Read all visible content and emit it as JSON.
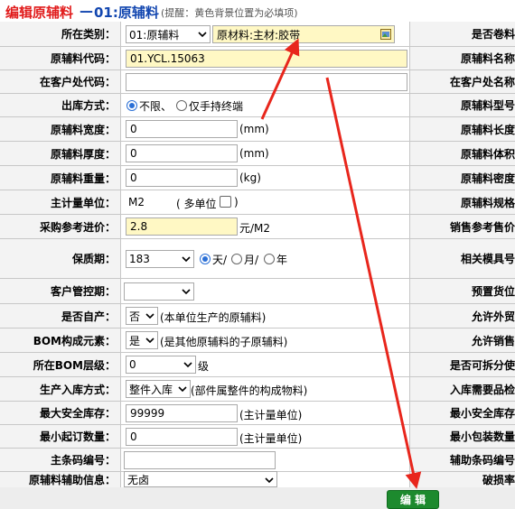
{
  "header": {
    "title_red": "编辑原辅料",
    "separator": "—",
    "title_blue": "01:原辅料",
    "hint": "(提醒：黄色背景位置为必填项)"
  },
  "rows": {
    "category": {
      "label": "所在类别：",
      "select_value": "01:原辅料",
      "path_value": "原材料:主材:胶带",
      "right_label": "是否卷料"
    },
    "code": {
      "label": "原辅料代码：",
      "value": "01.YCL.15063",
      "right_label": "原辅料名称"
    },
    "cust_code": {
      "label": "在客户处代码：",
      "value": "",
      "right_label": "在客户处名称"
    },
    "outbound": {
      "label": "出库方式：",
      "opt1": "不限、",
      "opt2": "仅手持终端",
      "right_label": "原辅料型号"
    },
    "width": {
      "label": "原辅料宽度：",
      "value": "0",
      "unit": "(mm)",
      "right_label": "原辅料长度"
    },
    "thickness": {
      "label": "原辅料厚度：",
      "value": "0",
      "unit": "(mm)",
      "right_label": "原辅料体积"
    },
    "weight": {
      "label": "原辅料重量：",
      "value": "0",
      "unit": "(kg)",
      "right_label": "原辅料密度"
    },
    "main_unit": {
      "label": "主计量单位：",
      "value": "M2",
      "multi": "( 多单位",
      "close": ")",
      "right_label": "原辅料规格"
    },
    "purchase_price": {
      "label": "采购参考进价：",
      "value": "2.8",
      "unit": "元/M2",
      "right_label": "销售参考售价"
    },
    "shelf_life": {
      "label": "保质期：",
      "value": "183",
      "opt_day": "天/",
      "opt_month": "月/",
      "opt_year": "年",
      "right_label": "相关模具号"
    },
    "customer_ctrl": {
      "label": "客户管控期：",
      "value": "",
      "right_label": "预置货位"
    },
    "self_produced": {
      "label": "是否自产：",
      "value": "否",
      "note": "(本单位生产的原辅料)",
      "right_label": "允许外贸"
    },
    "bom_element": {
      "label": "BOM构成元素：",
      "value": "是",
      "note": "(是其他原辅料的子原辅料)",
      "right_label": "允许销售"
    },
    "bom_level": {
      "label": "所在BOM层级：",
      "value": "0",
      "unit": "级",
      "right_label": "是否可拆分使"
    },
    "production_in": {
      "label": "生产入库方式：",
      "value": "整件入库",
      "note": "(部件属整件的构成物料)",
      "right_label": "入库需要品检"
    },
    "max_stock": {
      "label": "最大安全库存：",
      "value": "99999",
      "unit": "(主计量单位)",
      "right_label": "最小安全库存"
    },
    "min_order": {
      "label": "最小起订数量：",
      "value": "0",
      "unit": "(主计量单位)",
      "right_label": "最小包装数量"
    },
    "barcode": {
      "label": "主条码编号：",
      "value": "",
      "right_label": "辅助条码编号"
    },
    "aux_info": {
      "label": "原辅料辅助信息：",
      "value": "无卤",
      "right_label": "破损率"
    }
  },
  "footer": {
    "edit_button": "编 辑"
  },
  "colors": {
    "required_bg": "#fff8c4",
    "button": "#1d8a2e",
    "title_red": "#e11c1c",
    "title_blue": "#1347b0",
    "arrow": "#e8261c"
  }
}
